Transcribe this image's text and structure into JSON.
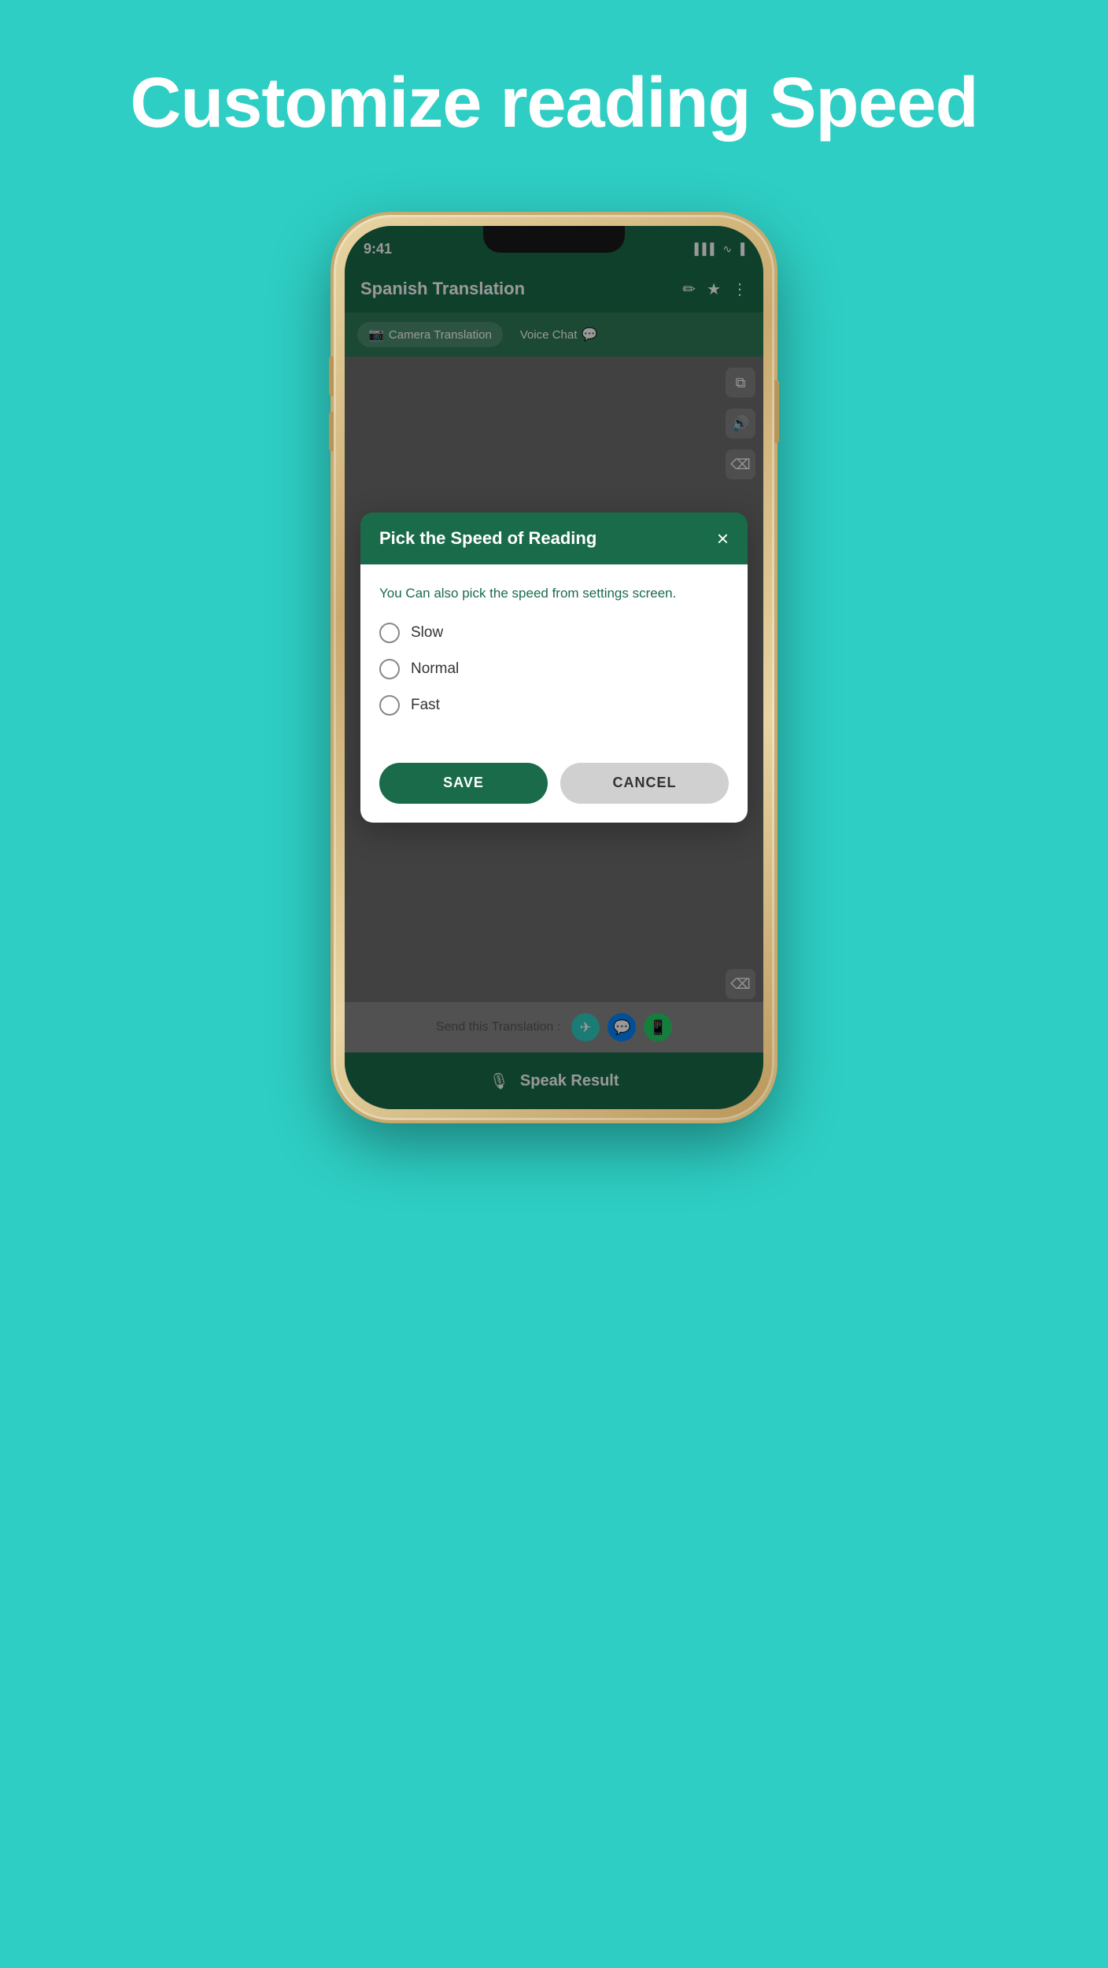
{
  "page": {
    "title": "Customize reading Speed",
    "bg_color": "#2ECEC4"
  },
  "phone": {
    "status": {
      "time": "9:41",
      "signal": "▌▌▌",
      "wifi": "wifi",
      "battery": "battery"
    },
    "header": {
      "title": "Spanish Translation",
      "icon1": "✏",
      "icon2": "★",
      "icon3": "⋮"
    },
    "tabs": [
      {
        "label": "Camera Translation",
        "icon": "📷",
        "active": true
      },
      {
        "label": "Voice Chat",
        "icon": "💬",
        "active": false
      }
    ],
    "bottom_bar": {
      "speak_result": "Speak Result"
    },
    "send_bar": {
      "label": "Send this Translation :"
    }
  },
  "modal": {
    "title": "Pick the Speed of Reading",
    "close_label": "×",
    "description": "You Can also pick the speed from settings screen.",
    "options": [
      {
        "label": "Slow",
        "selected": false
      },
      {
        "label": "Normal",
        "selected": false
      },
      {
        "label": "Fast",
        "selected": false
      }
    ],
    "save_label": "SAVE",
    "cancel_label": "CANCEL"
  }
}
